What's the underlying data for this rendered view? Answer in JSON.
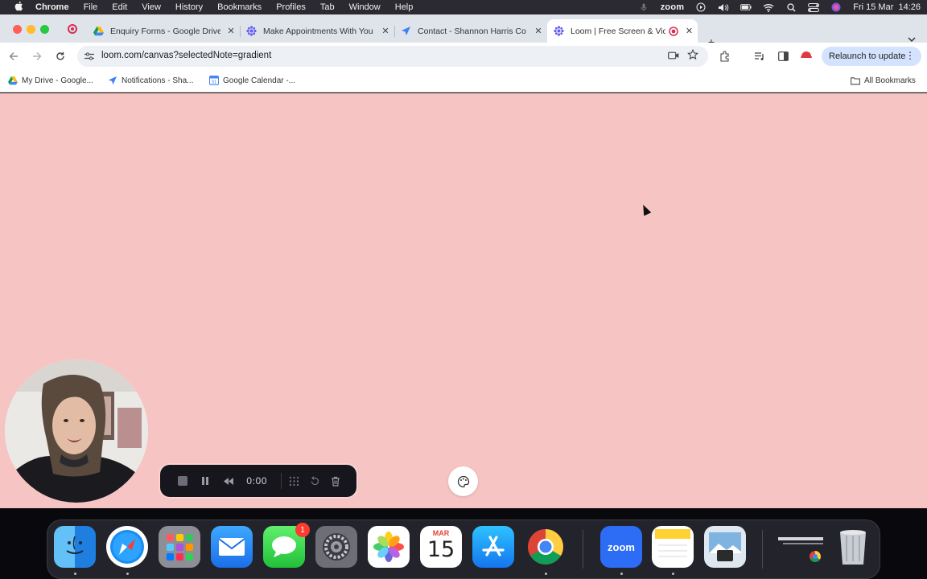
{
  "menubar": {
    "app_name": "Chrome",
    "items": [
      "File",
      "Edit",
      "View",
      "History",
      "Bookmarks",
      "Profiles",
      "Tab",
      "Window",
      "Help"
    ],
    "zoom_label": "zoom",
    "datetime": "Fri 15 Mar  14:26"
  },
  "tabs": [
    {
      "title": "Enquiry Forms - Google Drive",
      "icon": "google-drive-icon",
      "active": false
    },
    {
      "title": "Make Appointments With You",
      "icon": "scheduling-icon",
      "active": false
    },
    {
      "title": "Contact - Shannon Harris Co",
      "icon": "site-icon",
      "active": false
    },
    {
      "title": "Loom | Free Screen & Vide",
      "icon": "loom-icon",
      "active": true
    }
  ],
  "toolbar": {
    "url": "loom.com/canvas?selectedNote=gradient",
    "relaunch_label": "Relaunch to update"
  },
  "bookmarks": [
    {
      "label": "My Drive - Google...",
      "icon": "google-drive-icon"
    },
    {
      "label": "Notifications - Sha...",
      "icon": "notifications-icon"
    },
    {
      "label": "Google Calendar -...",
      "icon": "google-calendar-icon"
    }
  ],
  "all_bookmarks_label": "All Bookmarks",
  "page": {
    "background_color": "#f7c4c4"
  },
  "recorder": {
    "timer": "0:00"
  },
  "dock": {
    "messages_badge": "1",
    "calendar_month": "MAR",
    "calendar_day": "15",
    "zoom_label": "zoom",
    "apps": [
      "Finder",
      "Safari",
      "Launchpad",
      "Mail",
      "Messages",
      "System Settings",
      "Photos",
      "Calendar",
      "App Store",
      "Chrome",
      "Zoom",
      "Notes",
      "Preview",
      "Chrome Window",
      "Trash"
    ]
  }
}
